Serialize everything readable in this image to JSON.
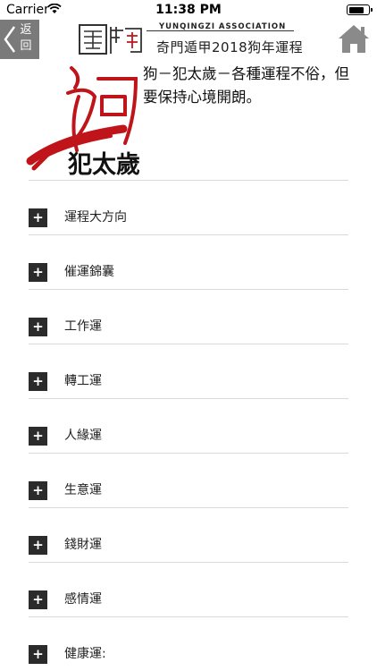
{
  "status_bar": {
    "carrier": "Carrier",
    "time": "11:38 PM"
  },
  "nav": {
    "back_label": "返回",
    "association": "YUNQINGZI ASSOCIATION",
    "subtitle": "奇門遁甲2018狗年運程"
  },
  "hero": {
    "caption": "犯太歲",
    "description": "狗－犯太歲－各種運程不俗，但要保持心境開朗。"
  },
  "menu": {
    "items": [
      {
        "label": "運程大方向"
      },
      {
        "label": "催運錦囊"
      },
      {
        "label": "工作運"
      },
      {
        "label": "轉工運"
      },
      {
        "label": "人緣運"
      },
      {
        "label": "生意運"
      },
      {
        "label": "錢財運"
      },
      {
        "label": "感情運"
      },
      {
        "label": "健康運:"
      }
    ]
  },
  "colors": {
    "accent": "#c0141b",
    "button": "#2b2b2b",
    "back_button": "#7a7a7a"
  }
}
